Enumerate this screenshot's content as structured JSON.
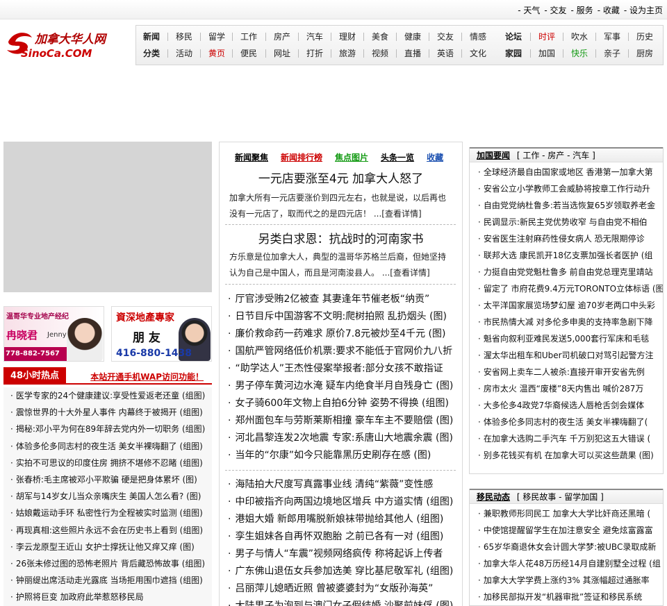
{
  "top_links": [
    "- 天气",
    "- 交友",
    "- 服务",
    "- 收藏",
    "- 设为主页"
  ],
  "logo": {
    "cn": "加拿大华人网",
    "en": "SinoCa.COM"
  },
  "nav": {
    "row1": [
      "新闻",
      "移民",
      "留学",
      "工作",
      "房产",
      "汽车",
      "理财",
      "美食",
      "健康",
      "交友",
      "情感",
      "论坛",
      "时评",
      "吹水",
      "军事",
      "历史"
    ],
    "row2": [
      "分类",
      "活动",
      "黄页",
      "便民",
      "网址",
      "打折",
      "旅游",
      "视频",
      "直播",
      "英语",
      "文化",
      "家园",
      "加国",
      "快乐",
      "亲子",
      "厨房"
    ]
  },
  "ads": {
    "left": {
      "title": "温哥华专业地产经纪",
      "name": "冉晓君",
      "en": "Jenny",
      "phone": "778-882-7567"
    },
    "right": {
      "title": "資深地產專家",
      "name": "朋 友",
      "phone": "416-880-1438"
    }
  },
  "hot48": {
    "tab": "48小时热点",
    "link": "本站开通手机WAP访问功能！",
    "items": [
      "医学专家的24个健康建议:享受性爱返老还童 (组图)",
      "震惊世界的十大外星人事件  内幕终于被揭开 (组图)",
      "揭秘:邓小平为何在89年辞去党内外一切职务 (组图)",
      "体验多伦多同志村的夜生活  美女半裸嗨翻了 (组图)",
      "实拍不可思议的印度住房  拥挤不堪修不忍睹 (组图)",
      "张春桥:毛主席被邓小平欺骗  硬是把身体累坏 (图)",
      "胡军与14岁女儿当众亲嘴庆生  美国人怎么看? (图)",
      "姑娘戴运动手环  私密性行为全程被实时监测 (组图)",
      "再现真相:这些照片永远不会在历史书上看到 (组图)",
      "李云龙原型王近山  女护士撑抚让他又痒又痒 (图)",
      "26张未修过图的恐怖老照片  背后藏恐怖故事 (组图)",
      "钟丽缇出席活动走光露底  当场拒用围巾遮挡 (组图)",
      "护照将巨变  加政府此举惹怒移民局"
    ]
  },
  "center": {
    "tabs": [
      "新闻聚焦",
      "新闻排行榜",
      "焦点图片",
      "头条一览",
      "收藏"
    ],
    "headline1": "一元店要涨至4元 加拿大人怒了",
    "summary1": "加拿大所有一元店要涨价到四元左右，也就是说，以后再也没有一元店了，取而代之的是四元店！ ...[查看详情]",
    "headline2": "另类白求恩：抗战时的河南家书",
    "summary2": "方乐意是位加拿大人，典型的温哥华苏格兰后裔，但她坚持认为自己是中国人，而且是河南浚县人。 ...[查看详情]",
    "list1": [
      "厅官涉受贿2亿被查  其妻逢年节催老板“纳贡”",
      "日节目斥中国游客不文明:爬树拍照  乱扔烟头 (图)",
      "廉价救命药一药难求  原价7.8元被炒至4千元 (图)",
      "国航严管网络低价机票:要求不能低于官网价九八折",
      "“助学达人”王杰性侵案举报者:部分女孩不敢指证",
      "男子停车黄河边水淹  疑车内绝食半月自残身亡 (图)",
      "女子骑600年文物上自拍6分钟  姿势不得换 (组图)",
      "郑州面包车与劳斯莱斯相撞  豪车车主不要赔偿 (图)",
      "河北昌黎连发2次地震  专家:系唐山大地震余震 (图)",
      "当年的“尔康”如今只能靠黑历史刷存在感 (图)"
    ],
    "list2": [
      "海陆拍大尺度写真露事业线  清纯“紫薇”变性感",
      "中印被指齐向两国边境地区增兵  中方道实情 (组图)",
      "港姐大婚  新郎用嘴脱新娘袜带抛给其他人 (组图)",
      "孪生姐妹各自再怀双胞胎  之前已各有一对 (组图)",
      "男子与情人“车震”视频网络疯传  称将起诉上传者",
      "广东佛山退伍女兵参加选美  穿比基尼敬军礼 (组图)",
      "吕丽萍儿媳晒近照  曾被婆婆封为“女版孙海英”",
      "大陆男子为泡到与澳门女子假结婚  沙聚前妹俘 (图)"
    ]
  },
  "right1": {
    "title": "加国要闻",
    "subs": "[  工作 - 房产 - 汽车  ]",
    "items": [
      "全球经济最自由国家或地区  香港第一加拿大第",
      "安省公立小学教师工会威胁将按章工作行动升",
      "自由党党纳杜鲁多:若当选恢复65岁领取养老金",
      "民调显示:新民主党优势收窄  与自由党不相伯",
      "安省医生注射麻药性侵女病人  恐无限期停诊",
      "联邦大选  康民凯开18亿支票加强长者医护 (组",
      "力挺自由党党魁杜鲁多  前自由党总理克里靖站",
      "留定了  市府花费9.4万元TORONTO立体标语 (图)",
      "太平洋国家展览场梦幻屋  逾70岁老两口中头彩",
      "市民热情大减  对多伦多申奥的支持率急剧下降",
      "魁省向叙利亚难民发送5,000套行军床和毛毯",
      "渥太华出租车和Uber司机破口对骂引起警方注",
      "安省网上卖车二人被杀:直接开审开安省先例",
      "房市太火  温西“废楼”8天内售出  喊价287万",
      "大多伦多4政党7华裔候选人唇枪舌剑会媒体",
      "体验多伦多同志村的夜生活  美女半裸嗨翻了(",
      "在加拿大选购二手汽车  千万别犯这五大错误 (",
      "别多花钱买有机  在加拿大可以买这些蔬果 (图)"
    ]
  },
  "right2": {
    "title": "移民动态",
    "subs": "[  移民故事 - 留学加国  ]",
    "items": [
      "兼职教师形同民工  加拿大大学比奸商还黑暗 (",
      "中使馆提醒留学生在加注意安全  避免炫富露富",
      "65岁华裔退休女会计圆大学梦:被UBC录取成新",
      "加拿大华人花48万历经14月自建别墅全过程 (组",
      "加拿大大学学费上涨约3%  其涨幅超过通胀率",
      "加移民部拟开发“机器审批”签证和移民系统"
    ]
  },
  "colors": {
    "red": "#cc0000",
    "green": "#119911",
    "blue": "#1a4fb0"
  }
}
